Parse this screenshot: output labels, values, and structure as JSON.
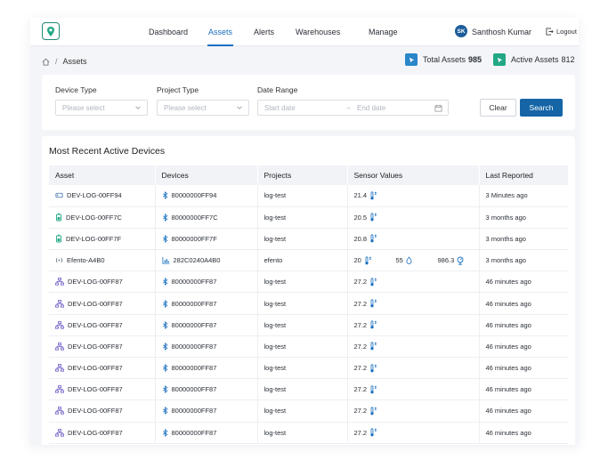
{
  "topbar": {
    "nav": [
      {
        "label": "Dashboard",
        "active": false
      },
      {
        "label": "Assets",
        "active": true
      },
      {
        "label": "Alerts",
        "active": false
      },
      {
        "label": "Warehouses",
        "active": false
      },
      {
        "label": "Manage",
        "active": false
      }
    ],
    "user": {
      "initials": "SK",
      "name": "Santhosh Kumar"
    },
    "logout_label": "Logout"
  },
  "breadcrumb": {
    "separator": "/",
    "current": "Assets"
  },
  "kpis": {
    "total": {
      "label": "Total Assets",
      "value": "985"
    },
    "active": {
      "label": "Active Assets",
      "value": "812"
    }
  },
  "filters": {
    "device_type": {
      "label": "Device Type",
      "placeholder": "Please select"
    },
    "project_type": {
      "label": "Project Type",
      "placeholder": "Please select"
    },
    "date_range": {
      "label": "Date Range",
      "start_placeholder": "Start date",
      "end_placeholder": "End date"
    },
    "clear_label": "Clear",
    "search_label": "Search"
  },
  "table": {
    "title": "Most Recent Active Devices",
    "columns": [
      "Asset",
      "Devices",
      "Projects",
      "Sensor Values",
      "Last Reported"
    ],
    "rows": [
      {
        "asset": "DEV-LOG-00FF94",
        "asset_icon": "tag-icon",
        "device": "80000000FF94",
        "device_icon": "bluetooth-icon",
        "project": "log-test",
        "sensors": [
          {
            "value": "21.4",
            "icon": "thermometer-icon"
          }
        ],
        "last": "3 Minutes ago"
      },
      {
        "asset": "DEV-LOG-00FF7C",
        "asset_icon": "battery-icon",
        "device": "80000000FF7C",
        "device_icon": "bluetooth-icon",
        "project": "log-test",
        "sensors": [
          {
            "value": "20.5",
            "icon": "thermometer-icon"
          }
        ],
        "last": "3 months ago"
      },
      {
        "asset": "DEV-LOG-00FF7F",
        "asset_icon": "battery-icon",
        "device": "80000000FF7F",
        "device_icon": "bluetooth-icon",
        "project": "log-test",
        "sensors": [
          {
            "value": "20.8",
            "icon": "thermometer-icon"
          }
        ],
        "last": "3 months ago"
      },
      {
        "asset": "Efento-A4B0",
        "asset_icon": "signal-icon",
        "device": "282C0240A4B0",
        "device_icon": "chart-icon",
        "project": "efento",
        "sensors": [
          {
            "value": "20",
            "icon": "thermometer-icon"
          },
          {
            "value": "55",
            "icon": "droplet-icon"
          },
          {
            "value": "986.3",
            "icon": "pressure-icon"
          }
        ],
        "last": "3 months ago"
      },
      {
        "asset": "DEV-LOG-00FF87",
        "asset_icon": "network-icon",
        "device": "80000000FF87",
        "device_icon": "bluetooth-icon",
        "project": "log-test",
        "sensors": [
          {
            "value": "27.2",
            "icon": "thermometer-icon"
          }
        ],
        "last": "46 minutes ago"
      },
      {
        "asset": "DEV-LOG-00FF87",
        "asset_icon": "network-icon",
        "device": "80000000FF87",
        "device_icon": "bluetooth-icon",
        "project": "log-test",
        "sensors": [
          {
            "value": "27.2",
            "icon": "thermometer-icon"
          }
        ],
        "last": "46 minutes ago"
      },
      {
        "asset": "DEV-LOG-00FF87",
        "asset_icon": "network-icon",
        "device": "80000000FF87",
        "device_icon": "bluetooth-icon",
        "project": "log-test",
        "sensors": [
          {
            "value": "27.2",
            "icon": "thermometer-icon"
          }
        ],
        "last": "46 minutes ago"
      },
      {
        "asset": "DEV-LOG-00FF87",
        "asset_icon": "network-icon",
        "device": "80000000FF87",
        "device_icon": "bluetooth-icon",
        "project": "log-test",
        "sensors": [
          {
            "value": "27.2",
            "icon": "thermometer-icon"
          }
        ],
        "last": "46 minutes ago"
      },
      {
        "asset": "DEV-LOG-00FF87",
        "asset_icon": "network-icon",
        "device": "80000000FF87",
        "device_icon": "bluetooth-icon",
        "project": "log-test",
        "sensors": [
          {
            "value": "27.2",
            "icon": "thermometer-icon"
          }
        ],
        "last": "46 minutes ago"
      },
      {
        "asset": "DEV-LOG-00FF87",
        "asset_icon": "network-icon",
        "device": "80000000FF87",
        "device_icon": "bluetooth-icon",
        "project": "log-test",
        "sensors": [
          {
            "value": "27.2",
            "icon": "thermometer-icon"
          }
        ],
        "last": "46 minutes ago"
      },
      {
        "asset": "DEV-LOG-00FF87",
        "asset_icon": "network-icon",
        "device": "80000000FF87",
        "device_icon": "bluetooth-icon",
        "project": "log-test",
        "sensors": [
          {
            "value": "27.2",
            "icon": "thermometer-icon"
          }
        ],
        "last": "46 minutes ago"
      },
      {
        "asset": "DEV-LOG-00FF87",
        "asset_icon": "network-icon",
        "device": "80000000FF87",
        "device_icon": "bluetooth-icon",
        "project": "log-test",
        "sensors": [
          {
            "value": "27.2",
            "icon": "thermometer-icon"
          }
        ],
        "last": "46 minutes ago"
      }
    ]
  },
  "colors": {
    "primary": "#1565a6",
    "accent_blue": "#1a6fbf",
    "accent_green": "#22a884"
  }
}
